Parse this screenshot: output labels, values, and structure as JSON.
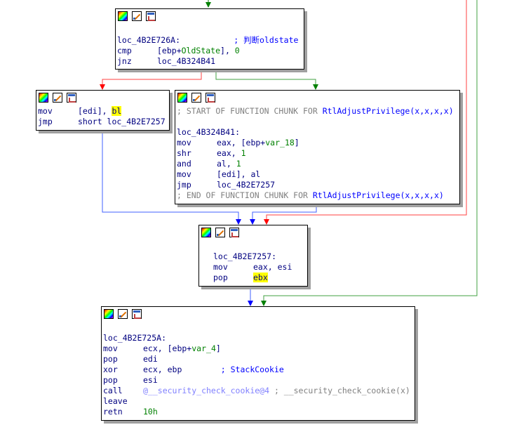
{
  "node_top": {
    "label_line": "loc_4B2E726A:",
    "label_comment": "; 判断oldstate",
    "ins1_mn": "cmp",
    "ins1_a": "[ebp+",
    "ins1_var": "OldState",
    "ins1_b": "], ",
    "ins1_num": "0",
    "ins2_mn": "jnz",
    "ins2_op": "loc_4B324B41"
  },
  "node_left": {
    "ins1_mn": "mov",
    "ins1_op": "[edi], ",
    "ins1_reg": "bl",
    "ins2_mn": "jmp",
    "ins2_op": "short loc_4B2E7257"
  },
  "node_right": {
    "chunk_start_a": "; START OF FUNCTION CHUNK FOR ",
    "chunk_fn": "RtlAdjustPrivilege(x,x,x,x)",
    "label_line": "loc_4B324B41:",
    "ins1_mn": "mov",
    "ins1_a": "eax, [ebp+",
    "ins1_var": "var_18",
    "ins1_b": "]",
    "ins2_mn": "shr",
    "ins2_a": "eax, ",
    "ins2_num": "1",
    "ins3_mn": "and",
    "ins3_a": "al, ",
    "ins3_num": "1",
    "ins4_mn": "mov",
    "ins4_op": "[edi], al",
    "ins5_mn": "jmp",
    "ins5_op": "loc_4B2E7257",
    "chunk_end_a": "; END OF FUNCTION CHUNK FOR ",
    "chunk_end_fn": "RtlAdjustPrivilege(x,x,x,x)"
  },
  "node_mid": {
    "label_line": "loc_4B2E7257:",
    "ins1_mn": "mov",
    "ins1_op": "eax, esi",
    "ins2_mn": "pop",
    "ins2_reg": "ebx"
  },
  "node_bottom": {
    "label_line": "loc_4B2E725A:",
    "ins1_mn": "mov",
    "ins1_a": "ecx, [ebp+",
    "ins1_var": "var_4",
    "ins1_b": "]",
    "ins2_mn": "pop",
    "ins2_op": "edi",
    "ins3_mn": "xor",
    "ins3_op": "ecx, ebp        ",
    "ins3_cm": "; StackCookie",
    "ins4_mn": "pop",
    "ins4_op": "esi",
    "ins5_mn": "call",
    "ins5_imp": "@__security_check_cookie@4",
    "ins5_cm": " ; __security_check_cookie(x)",
    "ins6_mn": "leave",
    "ins7_mn": "retn",
    "ins7_num": "10h"
  },
  "icons": [
    "color-palette-icon",
    "edit-pencil-icon",
    "graph-view-icon"
  ],
  "colors": {
    "true_edge": "#008000",
    "false_edge": "#ff0000",
    "uncond_edge": "#0000ff"
  }
}
